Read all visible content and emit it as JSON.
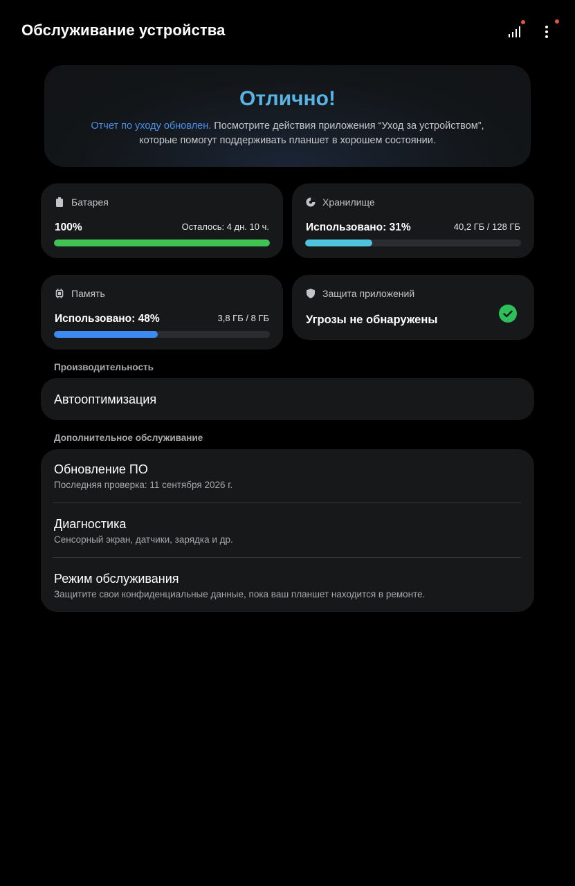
{
  "header": {
    "title": "Обслуживание устройства",
    "stats_icon": "bar-chart-icon",
    "more_icon": "more-vert-icon",
    "badge_color": "#e0573f"
  },
  "hero": {
    "title": "Отлично!",
    "link_text": "Отчет по уходу обновлен.",
    "text_line1": " Посмотрите действия приложения “Уход за устройством”,",
    "text_line2": "которые помогут поддерживать планшет в хорошем состоянии.",
    "title_color": "#58b4e4",
    "link_color": "#4a90e8"
  },
  "cards": {
    "battery": {
      "label": "Батарея",
      "icon": "battery-icon",
      "value": "100%",
      "side": "Осталось: 4 дн. 10 ч.",
      "level": 1.0,
      "color": "#3fc454"
    },
    "storage": {
      "label": "Хранилище",
      "icon": "pie-chart-icon",
      "value": "Использовано: 31%",
      "side": "40,2 ГБ / 128 ГБ",
      "level": 0.31,
      "color": "#4fc3de"
    },
    "memory": {
      "label": "Память",
      "icon": "memory-chip-icon",
      "value": "Использовано: 48%",
      "side": "3,8 ГБ / 8 ГБ",
      "level": 0.48,
      "color": "#3d8af2"
    },
    "protection": {
      "label": "Защита приложений",
      "icon": "shield-icon",
      "value": "Угрозы не обнаружены",
      "status_icon": "check-circle-icon",
      "status_color": "#2fbf5a"
    }
  },
  "performance": {
    "section_label": "Производительность",
    "auto_optimization": "Автооптимизация"
  },
  "additional": {
    "section_label": "Дополнительное обслуживание",
    "items": [
      {
        "title": "Обновление ПО",
        "subtitle": "Последняя проверка: 11 сентября 2026 г."
      },
      {
        "title": "Диагностика",
        "subtitle": "Сенсорный экран, датчики, зарядка и др."
      },
      {
        "title": "Режим обслуживания",
        "subtitle": "Защитите свои конфиденциальные данные, пока ваш планшет находится в ремонте."
      }
    ]
  }
}
